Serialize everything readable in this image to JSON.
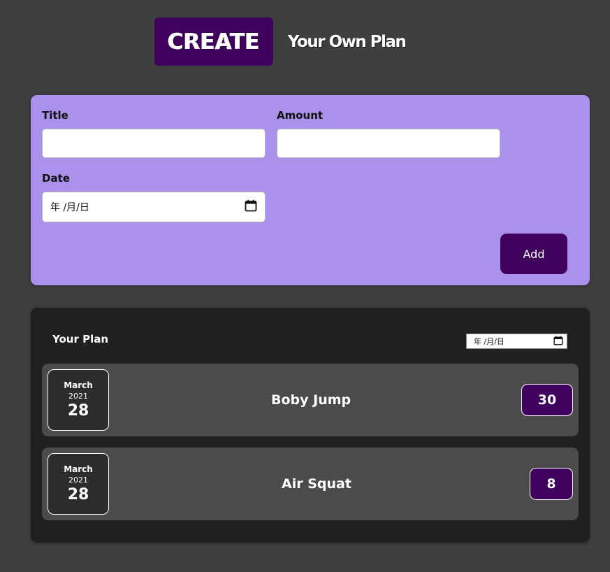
{
  "header": {
    "badge_text": "CREATE",
    "subtitle": "Your Own Plan"
  },
  "form": {
    "title_label": "Title",
    "title_value": "",
    "amount_label": "Amount",
    "amount_value": "",
    "date_label": "Date",
    "date_placeholder": "年 /月/日",
    "add_button_label": "Add"
  },
  "plan": {
    "title": "Your Plan",
    "filter_date_placeholder": "年 /月/日",
    "items": [
      {
        "month": "March",
        "year": "2021",
        "day": "28",
        "title": "Boby Jump",
        "amount": "30"
      },
      {
        "month": "March",
        "year": "2021",
        "day": "28",
        "title": "Air Squat",
        "amount": "8"
      }
    ]
  },
  "icons": {
    "calendar": "calendar-icon"
  },
  "colors": {
    "background": "#3f3f3f",
    "accent": "#40005d",
    "form_card": "#a991ec",
    "plan_card": "#202020",
    "plan_item": "#4b4b4b"
  }
}
